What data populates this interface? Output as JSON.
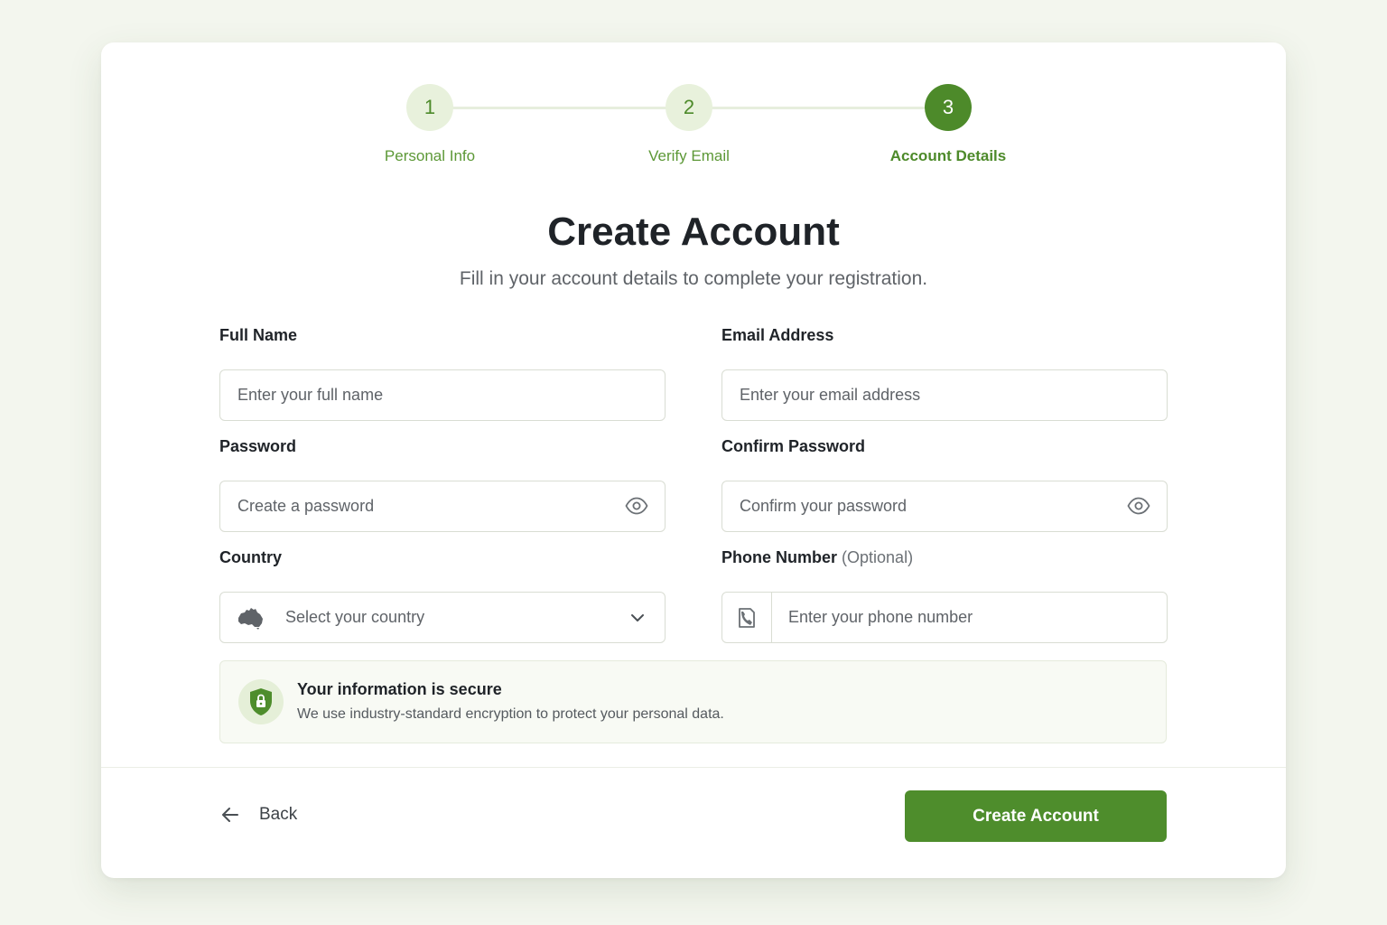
{
  "stepper": {
    "steps": [
      {
        "number": "1",
        "label": "Personal Info",
        "state": "completed"
      },
      {
        "number": "2",
        "label": "Verify Email",
        "state": "completed"
      },
      {
        "number": "3",
        "label": "Account Details",
        "state": "active"
      }
    ]
  },
  "header": {
    "title": "Create Account",
    "subtitle": "Fill in your account details to complete your registration."
  },
  "form": {
    "full_name": {
      "label": "Full Name",
      "placeholder": "Enter your full name",
      "value": ""
    },
    "email": {
      "label": "Email Address",
      "placeholder": "Enter your email address",
      "value": ""
    },
    "password": {
      "label": "Password",
      "placeholder": "Create a password",
      "value": "",
      "toggle_icon": "eye-icon"
    },
    "confirm_password": {
      "label": "Confirm Password",
      "placeholder": "Confirm your password",
      "value": "",
      "toggle_icon": "eye-icon"
    },
    "country": {
      "label": "Country",
      "placeholder": "Select your country",
      "selected": "",
      "icon": "australia-map-icon"
    },
    "phone": {
      "label": "Phone Number",
      "optional_note": "(Optional)",
      "placeholder": "Enter your phone number",
      "value": "",
      "icon": "phone-icon"
    }
  },
  "security_notice": {
    "title": "Your information is secure",
    "text": "We use industry-standard encryption to protect your personal data.",
    "icon": "shield-lock-icon"
  },
  "footer": {
    "back_label": "Back",
    "submit_label": "Create Account"
  },
  "colors": {
    "accent": "#4e8d2c",
    "accent_light": "#e8f1dc",
    "background": "#f3f6ee"
  }
}
